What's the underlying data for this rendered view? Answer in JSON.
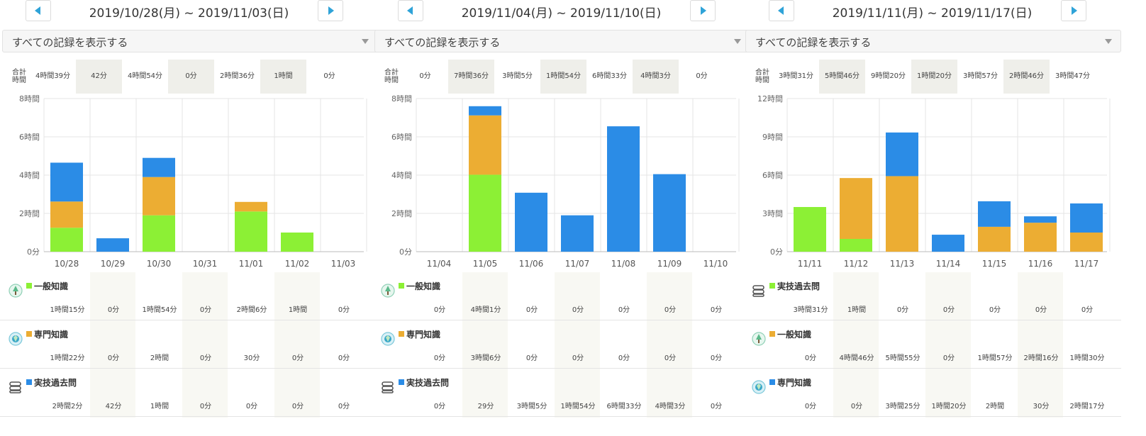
{
  "colors": {
    "green": "#8cf035",
    "orange": "#ecad33",
    "blue": "#2b8ce6",
    "accent": "#2fa3d8"
  },
  "panels": [
    {
      "title": "2019/10/28(月) ~ 2019/11/03(日)",
      "filter": "すべての記録を表示する",
      "total_label": "合計\n時間",
      "totals": [
        "4時間39分",
        "42分",
        "4時間54分",
        "0分",
        "2時間36分",
        "1時間",
        "0分"
      ],
      "chart_data": {
        "type": "bar",
        "stacked": true,
        "categories": [
          "10/28",
          "10/29",
          "10/30",
          "10/31",
          "11/01",
          "11/02",
          "11/03"
        ],
        "ylim": [
          0,
          8
        ],
        "yticks": [
          "0分",
          "2時間",
          "4時間",
          "6時間",
          "8時間"
        ],
        "series": [
          {
            "name": "一般知識",
            "color": "green",
            "values": [
              1.25,
              0,
              1.9,
              0,
              2.1,
              1.0,
              0
            ]
          },
          {
            "name": "専門知識",
            "color": "orange",
            "values": [
              1.37,
              0,
              2.0,
              0,
              0.5,
              0,
              0
            ]
          },
          {
            "name": "実技過去問",
            "color": "blue",
            "values": [
              2.03,
              0.7,
              1.0,
              0,
              0,
              0,
              0
            ]
          }
        ]
      },
      "subjects": [
        {
          "name": "一般知識",
          "icon": "tree-icon",
          "color": "green",
          "values": [
            "1時間15分",
            "0分",
            "1時間54分",
            "0分",
            "2時間6分",
            "1時間",
            "0分"
          ]
        },
        {
          "name": "専門知識",
          "icon": "globe-icon",
          "color": "orange",
          "values": [
            "1時間22分",
            "0分",
            "2時間",
            "0分",
            "30分",
            "0分",
            "0分"
          ]
        },
        {
          "name": "実技過去問",
          "icon": "scroll-icon",
          "color": "blue",
          "values": [
            "2時間2分",
            "42分",
            "1時間",
            "0分",
            "0分",
            "0分",
            "0分"
          ]
        }
      ]
    },
    {
      "title": "2019/11/04(月) ~ 2019/11/10(日)",
      "filter": "すべての記録を表示する",
      "total_label": "合計\n時間",
      "totals": [
        "0分",
        "7時間36分",
        "3時間5分",
        "1時間54分",
        "6時間33分",
        "4時間3分",
        "0分"
      ],
      "chart_data": {
        "type": "bar",
        "stacked": true,
        "categories": [
          "11/04",
          "11/05",
          "11/06",
          "11/07",
          "11/08",
          "11/09",
          "11/10"
        ],
        "ylim": [
          0,
          8
        ],
        "yticks": [
          "0分",
          "2時間",
          "4時間",
          "6時間",
          "8時間"
        ],
        "series": [
          {
            "name": "一般知識",
            "color": "green",
            "values": [
              0,
              4.02,
              0,
              0,
              0,
              0,
              0
            ]
          },
          {
            "name": "専門知識",
            "color": "orange",
            "values": [
              0,
              3.1,
              0,
              0,
              0,
              0,
              0
            ]
          },
          {
            "name": "実技過去問",
            "color": "blue",
            "values": [
              0,
              0.48,
              3.08,
              1.9,
              6.55,
              4.05,
              0
            ]
          }
        ]
      },
      "subjects": [
        {
          "name": "一般知識",
          "icon": "tree-icon",
          "color": "green",
          "values": [
            "0分",
            "4時間1分",
            "0分",
            "0分",
            "0分",
            "0分",
            "0分"
          ]
        },
        {
          "name": "専門知識",
          "icon": "globe-icon",
          "color": "orange",
          "values": [
            "0分",
            "3時間6分",
            "0分",
            "0分",
            "0分",
            "0分",
            "0分"
          ]
        },
        {
          "name": "実技過去問",
          "icon": "scroll-icon",
          "color": "blue",
          "values": [
            "0分",
            "29分",
            "3時間5分",
            "1時間54分",
            "6時間33分",
            "4時間3分",
            "0分"
          ]
        }
      ]
    },
    {
      "title": "2019/11/11(月) ~ 2019/11/17(日)",
      "filter": "すべての記録を表示する",
      "total_label": "合計\n時間",
      "totals": [
        "3時間31分",
        "5時間46分",
        "9時間20分",
        "1時間20分",
        "3時間57分",
        "2時間46分",
        "3時間47分"
      ],
      "chart_data": {
        "type": "bar",
        "stacked": true,
        "categories": [
          "11/11",
          "11/12",
          "11/13",
          "11/14",
          "11/15",
          "11/16",
          "11/17"
        ],
        "ylim": [
          0,
          12
        ],
        "yticks": [
          "0分",
          "3時間",
          "6時間",
          "9時間",
          "12時間"
        ],
        "series": [
          {
            "name": "実技過去問",
            "color": "green",
            "values": [
              3.5,
              1.0,
              0,
              0,
              0,
              0,
              0
            ]
          },
          {
            "name": "一般知識",
            "color": "orange",
            "values": [
              0,
              4.77,
              5.92,
              0,
              1.95,
              2.27,
              1.5
            ]
          },
          {
            "name": "専門知識",
            "color": "blue",
            "values": [
              0,
              0,
              3.42,
              1.33,
              2.0,
              0.5,
              2.28
            ]
          }
        ]
      },
      "subjects": [
        {
          "name": "実技過去問",
          "icon": "scroll-icon",
          "color": "green",
          "values": [
            "3時間31分",
            "1時間",
            "0分",
            "0分",
            "0分",
            "0分",
            "0分"
          ]
        },
        {
          "name": "一般知識",
          "icon": "tree-icon",
          "color": "orange",
          "values": [
            "0分",
            "4時間46分",
            "5時間55分",
            "0分",
            "1時間57分",
            "2時間16分",
            "1時間30分"
          ]
        },
        {
          "name": "専門知識",
          "icon": "globe-icon",
          "color": "blue",
          "values": [
            "0分",
            "0分",
            "3時間25分",
            "1時間20分",
            "2時間",
            "30分",
            "2時間17分"
          ]
        }
      ]
    }
  ]
}
